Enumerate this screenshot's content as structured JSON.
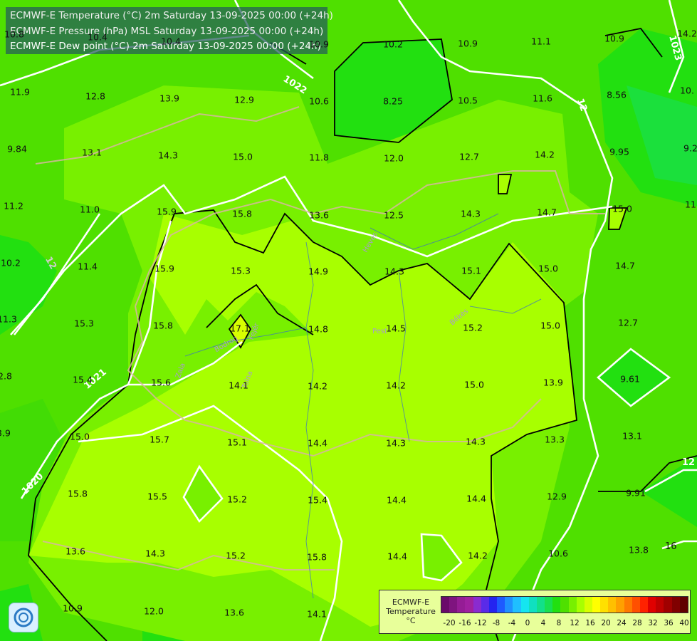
{
  "title_lines": [
    "ECMWF-E Temperature (°C) 2m Saturday 13-09-2025 00:00 (+24h)",
    "ECMWF-E Pressure (hPa) MSL Saturday 13-09-2025 00:00 (+24h)",
    "ECMWF-E Dew point (°C) 2m Saturday 13-09-2025 00:00 (+24h)"
  ],
  "legend": {
    "caption_lines": [
      "ECMWF-E",
      "Temperature",
      "°C"
    ],
    "ticks": [
      "-20",
      "-16",
      "-12",
      "-8",
      "-4",
      "0",
      "4",
      "8",
      "12",
      "16",
      "20",
      "24",
      "28",
      "32",
      "36",
      "40"
    ],
    "colors": [
      "#6a0a6a",
      "#7f147f",
      "#951c95",
      "#a020a0",
      "#8a2bd0",
      "#5a2be8",
      "#2424f0",
      "#1e5aff",
      "#1f90ff",
      "#1fbfff",
      "#15e5f0",
      "#10e0c0",
      "#12e08a",
      "#18e050",
      "#22e010",
      "#4fe000",
      "#78f000",
      "#a8ff00",
      "#d8ff00",
      "#ffff00",
      "#ffe000",
      "#ffc000",
      "#ffa000",
      "#ff7a00",
      "#ff5000",
      "#ff2200",
      "#e00000",
      "#c00000",
      "#a00000",
      "#800000",
      "#600000"
    ]
  },
  "isobar_labels": [
    "1022",
    "1023",
    "12",
    "1021",
    "1020",
    "12",
    "12",
    "16"
  ],
  "river_labels": [
    "Zala",
    "Bodrog",
    "Tolna",
    "Fejér",
    "Pest",
    "Békés",
    "Heves"
  ],
  "values": [
    "10.8",
    "10.4",
    "10.4",
    "10.9",
    "10.2",
    "10.9",
    "11.1",
    "10.9",
    "14.2",
    "11.9",
    "12.8",
    "13.9",
    "12.9",
    "10.6",
    "8.25",
    "10.5",
    "11.6",
    "8.56",
    "10.",
    "9.84",
    "13.1",
    "14.3",
    "15.0",
    "11.8",
    "12.0",
    "12.7",
    "14.2",
    "9.95",
    "9.2",
    "11.2",
    "11.0",
    "15.9",
    "15.8",
    "13.6",
    "12.5",
    "14.3",
    "14.7",
    "15.0",
    "11.",
    "10.2",
    "11.4",
    "15.9",
    "15.3",
    "14.9",
    "14.3",
    "15.1",
    "15.0",
    "14.7",
    "11.3",
    "15.3",
    "15.8",
    "17.1",
    "14.8",
    "14.5",
    "15.2",
    "15.0",
    "12.7",
    "2.8",
    "15.4",
    "15.6",
    "14.1",
    "14.2",
    "14.2",
    "15.0",
    "13.9",
    "9.61",
    "3.9",
    "15.0",
    "15.7",
    "15.1",
    "14.4",
    "14.3",
    "14.3",
    "13.3",
    "13.1",
    "15.8",
    "15.5",
    "15.2",
    "15.4",
    "14.4",
    "14.4",
    "12.9",
    "9.91",
    "13.6",
    "14.3",
    "15.2",
    "15.8",
    "14.4",
    "14.2",
    "10.6",
    "13.8",
    "10.9",
    "12.0",
    "13.6",
    "14.1",
    "13.8"
  ]
}
